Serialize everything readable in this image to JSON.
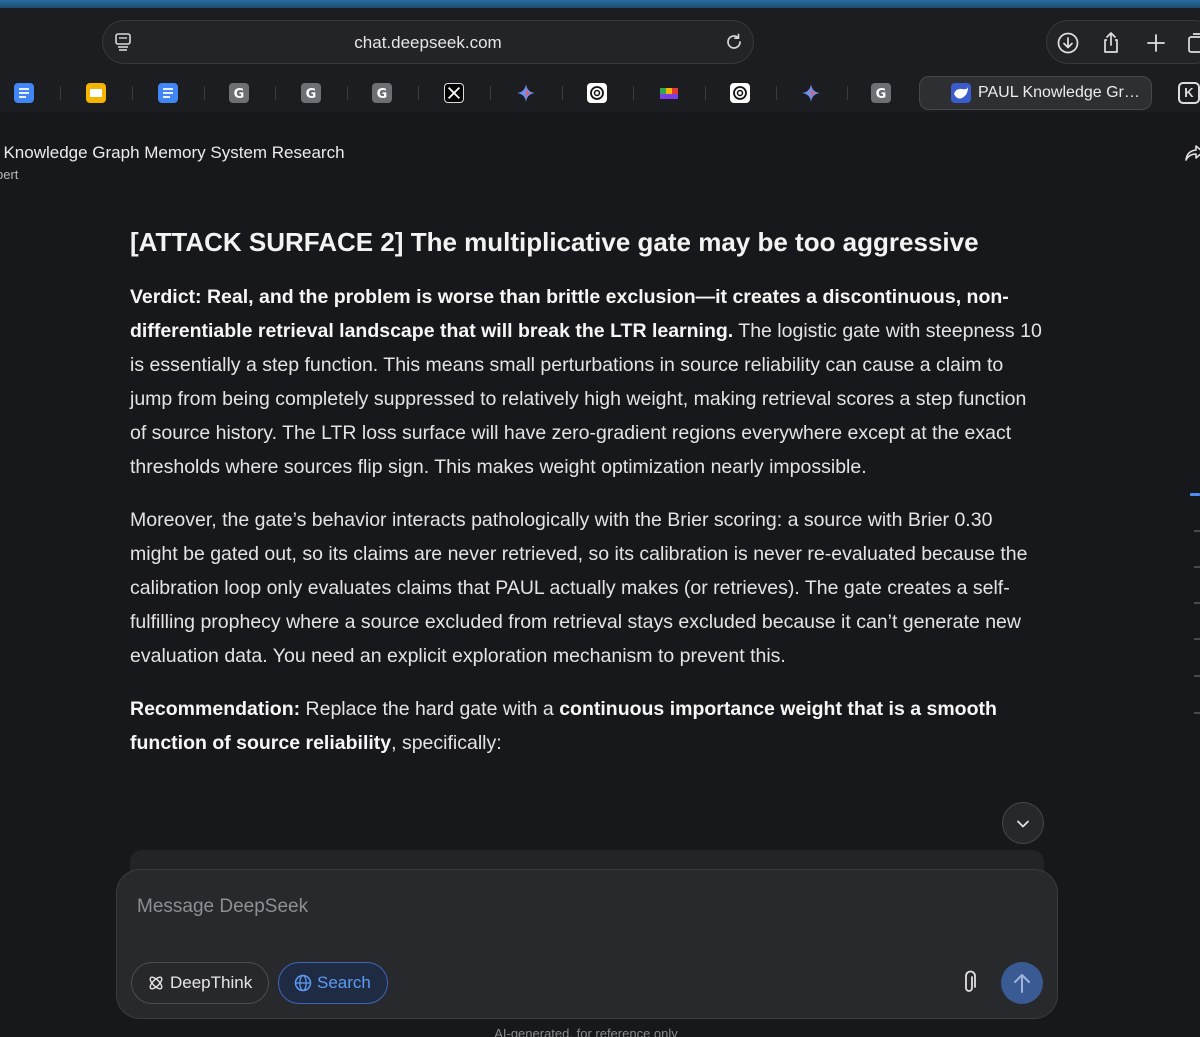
{
  "browser": {
    "url": "chat.deepseek.com",
    "active_tab_label": "PAUL Knowledge Gr…",
    "k_tab_letter": "K",
    "favicons": [
      "google-docs-icon",
      "google-slides-icon",
      "google-docs-icon",
      "g-icon",
      "g-icon",
      "g-icon",
      "x-icon",
      "gemini-icon",
      "chatgpt-icon",
      "news-icon",
      "chatgpt-icon",
      "gemini-icon",
      "g-icon"
    ]
  },
  "chat": {
    "title": ". Knowledge Graph Memory System Research",
    "subtitle": "bert"
  },
  "article": {
    "heading": "[ATTACK SURFACE 2] The multiplicative gate may be too aggressive",
    "p1_bold": "Verdict: Real, and the problem is worse than brittle exclusion—it creates a discontinuous, non-differentiable retrieval landscape that will break the LTR learning.",
    "p1_rest": " The logistic gate with steepness 10 is essentially a step function. This means small perturbations in source reliability can cause a claim to jump from being completely suppressed to relatively high weight, making retrieval scores a step function of source history. The LTR loss surface will have zero-gradient regions everywhere except at the exact thresholds where sources flip sign. This makes weight optimization nearly impossible.",
    "p2": "Moreover, the gate’s behavior interacts pathologically with the Brier scoring: a source with Brier 0.30 might be gated out, so its claims are never retrieved, so its calibration is never re-evaluated because the calibration loop only evaluates claims that PAUL actually makes (or retrieves). The gate creates a self-fulfilling prophecy where a source excluded from retrieval stays excluded because it can’t generate new evaluation data. You need an explicit exploration mechanism to prevent this.",
    "p3_label": "Recommendation:",
    "p3_mid": " Replace the hard gate with a ",
    "p3_bold": "continuous importance weight that is a smooth function of source reliability",
    "p3_end": ", specifically:"
  },
  "composer": {
    "placeholder": "Message DeepSeek",
    "deepthink_label": "DeepThink",
    "search_label": "Search"
  },
  "footer": {
    "note": "AI-generated, for reference only"
  },
  "colors": {
    "background": "#17181b",
    "accent_blue": "#4d8df6",
    "search_pill_text": "#5b9bf6",
    "send_button": "#3a5a94"
  }
}
